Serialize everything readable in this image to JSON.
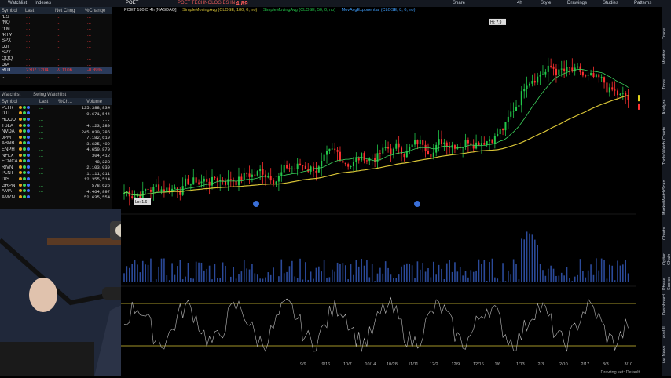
{
  "topbar": {
    "tabs": [
      "Watchlist",
      "Indexes"
    ],
    "symbol": "POET",
    "company": "POET TECHNOLOGIES IN",
    "price": "4.89",
    "menu": [
      "Share",
      "4h",
      "Style",
      "Drawings",
      "Studies",
      "Patterns"
    ]
  },
  "watchlist1": {
    "columns": [
      "Symbol",
      "Last",
      "Net Chng",
      "%Change"
    ],
    "rows": [
      {
        "sym": "/ES",
        "last": "...",
        "chg": "...",
        "pct": "...",
        "color": "#ff3b3b"
      },
      {
        "sym": "/NQ",
        "last": "...",
        "chg": "...",
        "pct": "...",
        "color": "#ff3b3b"
      },
      {
        "sym": "/YM",
        "last": "...",
        "chg": "...",
        "pct": "...",
        "color": "#ff3b3b"
      },
      {
        "sym": "/RTY",
        "last": "...",
        "chg": "...",
        "pct": "...",
        "color": "#ff3b3b"
      },
      {
        "sym": "SPX",
        "last": "...",
        "chg": "...",
        "pct": "...",
        "color": "#ff3b3b"
      },
      {
        "sym": "DJI",
        "last": "...",
        "chg": "...",
        "pct": "...",
        "color": "#ff3b3b"
      },
      {
        "sym": "SPY",
        "last": "...",
        "chg": "...",
        "pct": "...",
        "color": "#ff3b3b"
      },
      {
        "sym": "QQQ",
        "last": "...",
        "chg": "...",
        "pct": "...",
        "color": "#ff3b3b"
      },
      {
        "sym": "DIA",
        "last": "...",
        "chg": "...",
        "pct": "...",
        "color": "#ff3b3b"
      },
      {
        "sym": "RUT",
        "last": "2307.1204",
        "chg": "-9.1106",
        "pct": "-0.39%",
        "color": "#ff3b3b",
        "selected": true
      },
      {
        "sym": "...",
        "last": "...",
        "chg": "...",
        "pct": "...",
        "color": "#ff3b3b"
      }
    ]
  },
  "watchlist2": {
    "tabs": [
      "Watchlist",
      "Swing Watchlist"
    ],
    "columns": [
      "Symbol",
      "Last",
      "%Ch...",
      "Volume"
    ],
    "rows": [
      {
        "sym": "PLTR",
        "pct": "...",
        "vol": "125,388,834",
        "color": "#3cd35c"
      },
      {
        "sym": "DJT",
        "pct": "...",
        "vol": "9,671,544",
        "color": "#3cd35c"
      },
      {
        "sym": "HOOD",
        "pct": "...",
        "vol": "...",
        "color": "#3cd35c"
      },
      {
        "sym": "TSLA",
        "pct": "...",
        "vol": "4,123,280",
        "color": "#3cd35c"
      },
      {
        "sym": "NVDA",
        "pct": "...",
        "vol": "245,030,786",
        "color": "#3cd35c"
      },
      {
        "sym": "JPM",
        "pct": "...",
        "vol": "7,182,619",
        "color": "#3cd35c"
      },
      {
        "sym": "ABNB",
        "pct": "...",
        "vol": "3,625,409",
        "color": "#3cd35c"
      },
      {
        "sym": "ENPH",
        "pct": "...",
        "vol": "4,650,870",
        "color": "#3cd35c"
      },
      {
        "sym": "NFLX",
        "pct": "...",
        "vol": "304,412",
        "color": "#3cd35c"
      },
      {
        "sym": "FCNCA",
        "pct": "...",
        "vol": "48,228",
        "color": "#3cd35c"
      },
      {
        "sym": "RIVN",
        "pct": "...",
        "vol": "2,103,039",
        "color": "#3cd35c"
      },
      {
        "sym": "PLNT",
        "pct": "...",
        "vol": "1,111,611",
        "color": "#3cd35c"
      },
      {
        "sym": "DIS",
        "pct": "...",
        "vol": "12,355,514",
        "color": "#3cd35c"
      },
      {
        "sym": "GRPN",
        "pct": "...",
        "vol": "578,626",
        "color": "#3cd35c"
      },
      {
        "sym": "AMAT",
        "pct": "...",
        "vol": "4,464,897",
        "color": "#3cd35c"
      },
      {
        "sym": "AMZN",
        "pct": "...",
        "vol": "52,635,554",
        "color": "#3cd35c"
      }
    ]
  },
  "chart": {
    "header": "POET 180 D 4h [NASDAQ]",
    "study1": "SimpleMovingAvg (CLOSE, 180, 0, no)",
    "study2": "SimpleMovingAvg (CLOSE, 50, 0, no)",
    "study3": "MovAvgExponential (CLOSE, 8, 0, no)",
    "y_ticks": [
      "8",
      "7.5",
      "7",
      "6.5",
      "6",
      "5.5",
      "5",
      "4.5",
      "4",
      "3.5",
      "3",
      "2.5",
      "2",
      "1.5",
      "1"
    ],
    "x_ticks": [
      "9/9",
      "9/16",
      "10/7",
      "10/14",
      "10/28",
      "11/11",
      "12/2",
      "12/9",
      "12/16",
      "1/6",
      "1/13",
      "2/3",
      "2/10",
      "2/17",
      "3/3",
      "3/10"
    ],
    "hi_label": "Hi: 7.9",
    "lo_label": "Lo: 1.6",
    "price_badges": [
      "5.2",
      "4.89"
    ],
    "ind_ticks": [
      "80",
      "50",
      "20"
    ],
    "status": "Drawing set: Default"
  },
  "right_tabs": [
    "Trade",
    "Monitor",
    "Tools",
    "Analyze",
    "Charts",
    "Tools Watch",
    "Scan",
    "MarketWatch",
    "Charts",
    "Option Chain",
    "Phase Scores",
    "Dashboard",
    "Level II",
    "Live News"
  ],
  "colors": {
    "up": "#22c84a",
    "down": "#ff3030",
    "sma180": "#d8c436",
    "ema": "#3fa0ff",
    "bg": "#000000"
  }
}
